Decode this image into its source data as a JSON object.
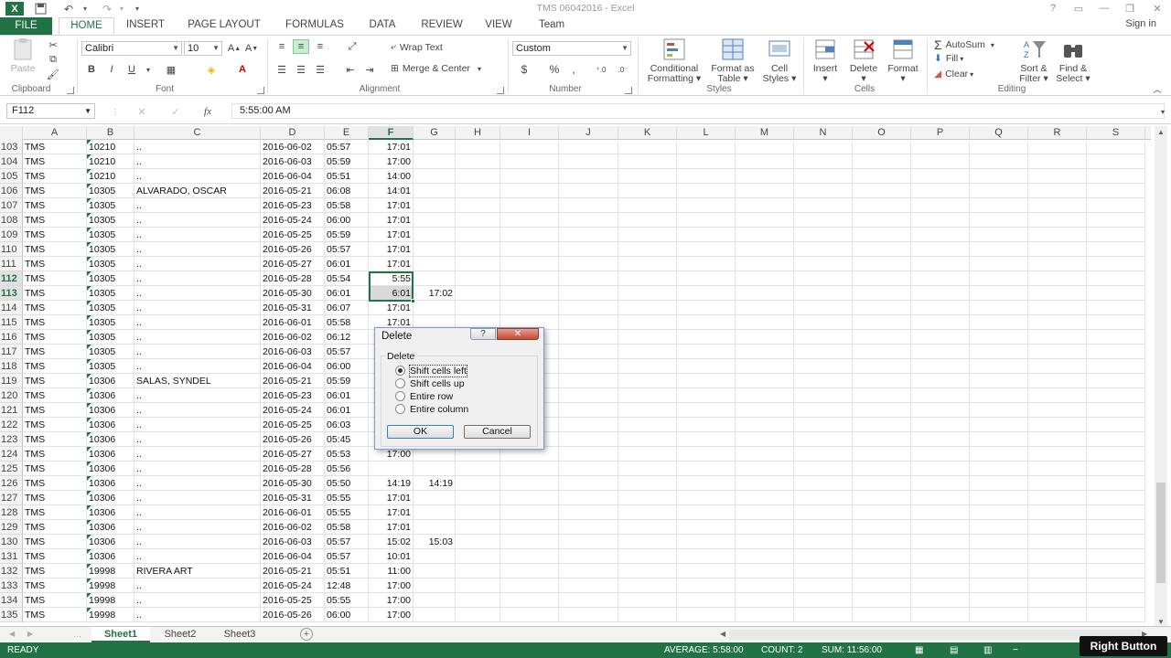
{
  "window": {
    "title": "TMS 06042016 - Excel",
    "sign_in": "Sign in"
  },
  "tabs": [
    "FILE",
    "HOME",
    "INSERT",
    "PAGE LAYOUT",
    "FORMULAS",
    "DATA",
    "REVIEW",
    "VIEW",
    "Team"
  ],
  "ribbon": {
    "clipboard": {
      "label": "Clipboard",
      "paste": "Paste"
    },
    "font": {
      "label": "Font",
      "name": "Calibri",
      "size": "10",
      "bold": "B",
      "italic": "I",
      "underline": "U"
    },
    "alignment": {
      "label": "Alignment",
      "wrap": "Wrap Text",
      "merge": "Merge & Center"
    },
    "number": {
      "label": "Number",
      "format": "Custom",
      "currency": "$",
      "percent": "%",
      "comma": ","
    },
    "styles": {
      "label": "Styles",
      "conditional": "Conditional",
      "conditional2": "Formatting",
      "format_table": "Format as",
      "format_table2": "Table",
      "cell_styles": "Cell",
      "cell_styles2": "Styles"
    },
    "cells": {
      "label": "Cells",
      "insert": "Insert",
      "delete": "Delete",
      "format": "Format"
    },
    "editing": {
      "label": "Editing",
      "autosum": "AutoSum",
      "fill": "Fill",
      "clear": "Clear",
      "sort": "Sort &",
      "sort2": "Filter",
      "find": "Find &",
      "find2": "Select"
    }
  },
  "formula_bar": {
    "name_box": "F112",
    "fx": "fx",
    "value": "5:55:00 AM"
  },
  "columns": [
    "A",
    "B",
    "C",
    "D",
    "E",
    "F",
    "G",
    "H",
    "I",
    "J",
    "K",
    "L",
    "M",
    "N",
    "O",
    "P",
    "Q",
    "R",
    "S"
  ],
  "rows": [
    {
      "n": "103",
      "a": "TMS",
      "b": "10210",
      "c": "..",
      "d": "2016-06-02",
      "e": "05:57",
      "f": "17:01",
      "g": ""
    },
    {
      "n": "104",
      "a": "TMS",
      "b": "10210",
      "c": "..",
      "d": "2016-06-03",
      "e": "05:59",
      "f": "17:00",
      "g": ""
    },
    {
      "n": "105",
      "a": "TMS",
      "b": "10210",
      "c": "..",
      "d": "2016-06-04",
      "e": "05:51",
      "f": "14:00",
      "g": ""
    },
    {
      "n": "106",
      "a": "TMS",
      "b": "10305",
      "c": "ALVARADO, OSCAR",
      "d": "2016-05-21",
      "e": "06:08",
      "f": "14:01",
      "g": ""
    },
    {
      "n": "107",
      "a": "TMS",
      "b": "10305",
      "c": "..",
      "d": "2016-05-23",
      "e": "05:58",
      "f": "17:01",
      "g": ""
    },
    {
      "n": "108",
      "a": "TMS",
      "b": "10305",
      "c": "..",
      "d": "2016-05-24",
      "e": "06:00",
      "f": "17:01",
      "g": ""
    },
    {
      "n": "109",
      "a": "TMS",
      "b": "10305",
      "c": "..",
      "d": "2016-05-25",
      "e": "05:59",
      "f": "17:01",
      "g": ""
    },
    {
      "n": "110",
      "a": "TMS",
      "b": "10305",
      "c": "..",
      "d": "2016-05-26",
      "e": "05:57",
      "f": "17:01",
      "g": ""
    },
    {
      "n": "111",
      "a": "TMS",
      "b": "10305",
      "c": "..",
      "d": "2016-05-27",
      "e": "06:01",
      "f": "17:01",
      "g": ""
    },
    {
      "n": "112",
      "a": "TMS",
      "b": "10305",
      "c": "..",
      "d": "2016-05-28",
      "e": "05:54",
      "f": "5:55",
      "g": ""
    },
    {
      "n": "113",
      "a": "TMS",
      "b": "10305",
      "c": "..",
      "d": "2016-05-30",
      "e": "06:01",
      "f": "6:01",
      "g": "17:02"
    },
    {
      "n": "114",
      "a": "TMS",
      "b": "10305",
      "c": "..",
      "d": "2016-05-31",
      "e": "06:07",
      "f": "17:01",
      "g": ""
    },
    {
      "n": "115",
      "a": "TMS",
      "b": "10305",
      "c": "..",
      "d": "2016-06-01",
      "e": "05:58",
      "f": "17:01",
      "g": ""
    },
    {
      "n": "116",
      "a": "TMS",
      "b": "10305",
      "c": "..",
      "d": "2016-06-02",
      "e": "06:12",
      "f": "",
      "g": ""
    },
    {
      "n": "117",
      "a": "TMS",
      "b": "10305",
      "c": "..",
      "d": "2016-06-03",
      "e": "05:57",
      "f": "",
      "g": ""
    },
    {
      "n": "118",
      "a": "TMS",
      "b": "10305",
      "c": "..",
      "d": "2016-06-04",
      "e": "06:00",
      "f": "",
      "g": ""
    },
    {
      "n": "119",
      "a": "TMS",
      "b": "10306",
      "c": "SALAS, SYNDEL",
      "d": "2016-05-21",
      "e": "05:59",
      "f": "",
      "g": ""
    },
    {
      "n": "120",
      "a": "TMS",
      "b": "10306",
      "c": "..",
      "d": "2016-05-23",
      "e": "06:01",
      "f": "",
      "g": ""
    },
    {
      "n": "121",
      "a": "TMS",
      "b": "10306",
      "c": "..",
      "d": "2016-05-24",
      "e": "06:01",
      "f": "",
      "g": ""
    },
    {
      "n": "122",
      "a": "TMS",
      "b": "10306",
      "c": "..",
      "d": "2016-05-25",
      "e": "06:03",
      "f": "",
      "g": ""
    },
    {
      "n": "123",
      "a": "TMS",
      "b": "10306",
      "c": "..",
      "d": "2016-05-26",
      "e": "05:45",
      "f": "",
      "g": ""
    },
    {
      "n": "124",
      "a": "TMS",
      "b": "10306",
      "c": "..",
      "d": "2016-05-27",
      "e": "05:53",
      "f": "17:00",
      "g": ""
    },
    {
      "n": "125",
      "a": "TMS",
      "b": "10306",
      "c": "..",
      "d": "2016-05-28",
      "e": "05:56",
      "f": "",
      "g": ""
    },
    {
      "n": "126",
      "a": "TMS",
      "b": "10306",
      "c": "..",
      "d": "2016-05-30",
      "e": "05:50",
      "f": "14:19",
      "g": "14:19"
    },
    {
      "n": "127",
      "a": "TMS",
      "b": "10306",
      "c": "..",
      "d": "2016-05-31",
      "e": "05:55",
      "f": "17:01",
      "g": ""
    },
    {
      "n": "128",
      "a": "TMS",
      "b": "10306",
      "c": "..",
      "d": "2016-06-01",
      "e": "05:55",
      "f": "17:01",
      "g": ""
    },
    {
      "n": "129",
      "a": "TMS",
      "b": "10306",
      "c": "..",
      "d": "2016-06-02",
      "e": "05:58",
      "f": "17:01",
      "g": ""
    },
    {
      "n": "130",
      "a": "TMS",
      "b": "10306",
      "c": "..",
      "d": "2016-06-03",
      "e": "05:57",
      "f": "15:02",
      "g": "15:03"
    },
    {
      "n": "131",
      "a": "TMS",
      "b": "10306",
      "c": "..",
      "d": "2016-06-04",
      "e": "05:57",
      "f": "10:01",
      "g": ""
    },
    {
      "n": "132",
      "a": "TMS",
      "b": "19998",
      "c": "RIVERA ART",
      "d": "2016-05-21",
      "e": "05:51",
      "f": "11:00",
      "g": ""
    },
    {
      "n": "133",
      "a": "TMS",
      "b": "19998",
      "c": "..",
      "d": "2016-05-24",
      "e": "12:48",
      "f": "17:00",
      "g": ""
    },
    {
      "n": "134",
      "a": "TMS",
      "b": "19998",
      "c": "..",
      "d": "2016-05-25",
      "e": "05:55",
      "f": "17:00",
      "g": ""
    },
    {
      "n": "135",
      "a": "TMS",
      "b": "19998",
      "c": "..",
      "d": "2016-05-26",
      "e": "06:00",
      "f": "17:00",
      "g": ""
    }
  ],
  "sheets": [
    "Sheet1",
    "Sheet2",
    "Sheet3"
  ],
  "status": {
    "mode": "READY",
    "average": "AVERAGE: 5:58:00",
    "count": "COUNT: 2",
    "sum": "SUM: 11:56:00"
  },
  "overlay": {
    "right_button": "Right Button"
  },
  "dialog": {
    "title": "Delete",
    "help": "?",
    "close": "✕",
    "group": "Delete",
    "options": [
      {
        "label": "Shift cells left",
        "selected": true
      },
      {
        "label": "Shift cells up",
        "selected": false
      },
      {
        "label": "Entire row",
        "selected": false
      },
      {
        "label": "Entire column",
        "selected": false
      }
    ],
    "ok": "OK",
    "cancel": "Cancel"
  },
  "colors": {
    "accent": "#217346",
    "selection": "#d9d9d9"
  }
}
